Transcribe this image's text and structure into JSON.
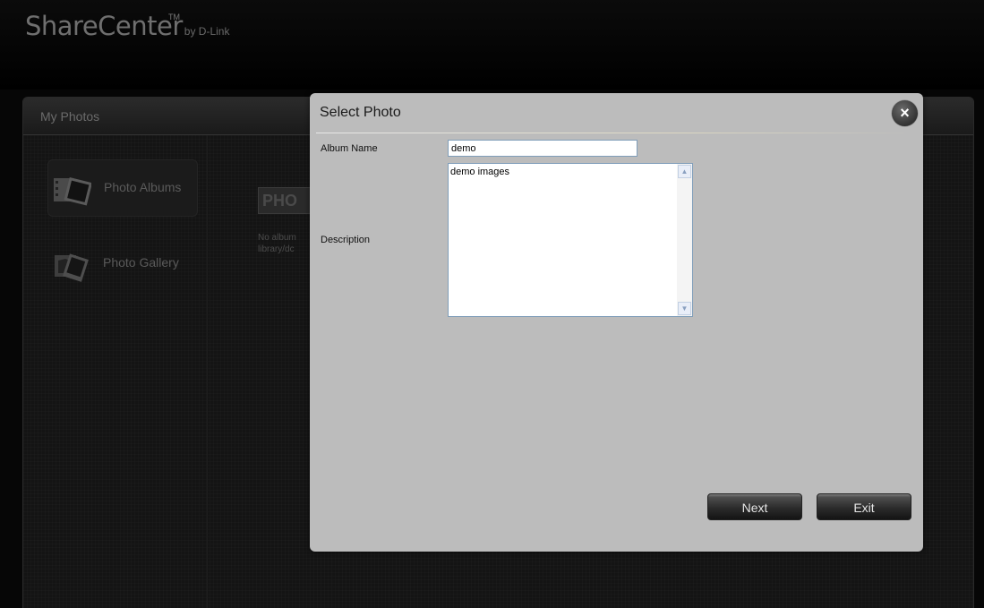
{
  "app": {
    "logo_main": "ShareCenter",
    "logo_tm": "TM",
    "logo_by": "by D-Link"
  },
  "panel": {
    "title": "My Photos",
    "nav": [
      {
        "label": "Photo Albums",
        "icon": "photo-albums-icon",
        "active": true
      },
      {
        "label": "Photo Gallery",
        "icon": "photo-gallery-icon",
        "active": false
      }
    ],
    "content_heading": "PHO",
    "content_note": "No album library/dc"
  },
  "dialog": {
    "title": "Select Photo",
    "close_label": "×",
    "album_name_label": "Album Name",
    "album_name_value": "demo",
    "description_label": "Description",
    "description_value": "demo images",
    "next_label": "Next",
    "exit_label": "Exit"
  },
  "colors": {
    "dialog_bg": "#bcbcbc",
    "overlay_bg": "#060606"
  }
}
